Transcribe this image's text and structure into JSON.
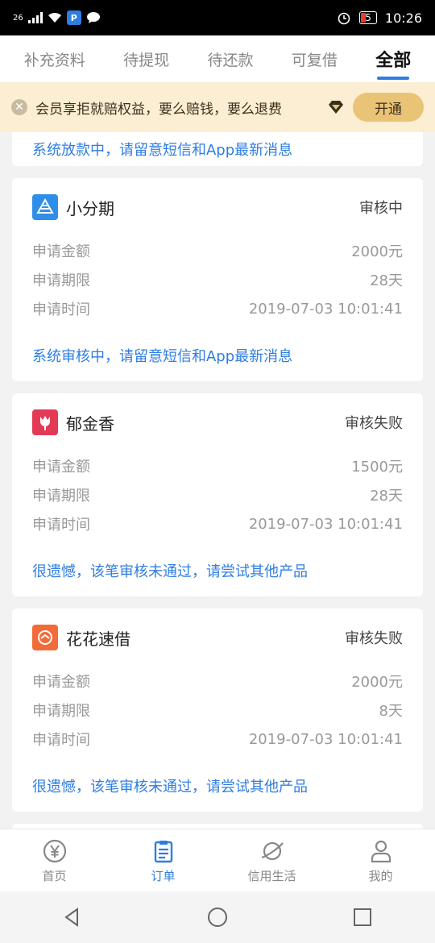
{
  "status_bar": {
    "network": "26",
    "battery": "5",
    "time": "10:26"
  },
  "tabs": [
    {
      "label": "补充资料",
      "active": false
    },
    {
      "label": "待提现",
      "active": false
    },
    {
      "label": "待还款",
      "active": false
    },
    {
      "label": "可复借",
      "active": false
    },
    {
      "label": "全部",
      "active": true
    }
  ],
  "banner": {
    "text": "会员享拒就赔权益，要么赔钱，要么退费",
    "button": "开通"
  },
  "partial_card": {
    "message": "系统放款中，请留意短信和App最新消息"
  },
  "orders": [
    {
      "name": "小分期",
      "status": "审核中",
      "amount_label": "申请金额",
      "amount": "2000元",
      "term_label": "申请期限",
      "term": "28天",
      "time_label": "申请时间",
      "time": "2019-07-03 10:01:41",
      "message": "系统审核中，请留意短信和App最新消息",
      "logo_color": "#2f8fe8"
    },
    {
      "name": "郁金香",
      "status": "审核失败",
      "amount_label": "申请金额",
      "amount": "1500元",
      "term_label": "申请期限",
      "term": "28天",
      "time_label": "申请时间",
      "time": "2019-07-03 10:01:41",
      "message": "很遗憾，该笔审核未通过，请尝试其他产品",
      "logo_color": "#e33a56"
    },
    {
      "name": "花花速借",
      "status": "审核失败",
      "amount_label": "申请金额",
      "amount": "2000元",
      "term_label": "申请期限",
      "term": "8天",
      "time_label": "申请时间",
      "time": "2019-07-03 10:01:41",
      "message": "很遗憾，该笔审核未通过，请尝试其他产品",
      "logo_color": "#f26b38"
    }
  ],
  "bottom_nav": [
    {
      "label": "首页",
      "icon": "yen-coin-icon",
      "active": false
    },
    {
      "label": "订单",
      "icon": "clipboard-icon",
      "active": true
    },
    {
      "label": "信用生活",
      "icon": "planet-icon",
      "active": false
    },
    {
      "label": "我的",
      "icon": "person-icon",
      "active": false
    }
  ],
  "colors": {
    "accent": "#2f7de1",
    "banner_bg": "#fbeed2",
    "banner_button": "#e9c476"
  }
}
